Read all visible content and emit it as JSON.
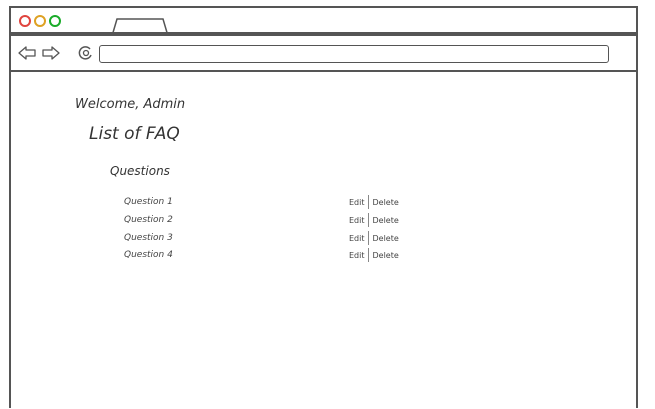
{
  "page": {
    "welcome": "Welcome, Admin",
    "title": "List of FAQ",
    "section_heading": "Questions",
    "questions": [
      {
        "label": "Question 1",
        "edit": "Edit",
        "delete": "Delete"
      },
      {
        "label": "Question 2",
        "edit": "Edit",
        "delete": "Delete"
      },
      {
        "label": "Question 3",
        "edit": "Edit",
        "delete": "Delete"
      },
      {
        "label": "Question 4",
        "edit": "Edit",
        "delete": "Delete"
      }
    ]
  },
  "browser": {
    "url_value": "",
    "icons": [
      "back-arrow-icon",
      "forward-arrow-icon",
      "reload-icon"
    ],
    "window_buttons": {
      "close": "#e0443e",
      "minimize": "#dea123",
      "maximize": "#1aab29"
    }
  }
}
